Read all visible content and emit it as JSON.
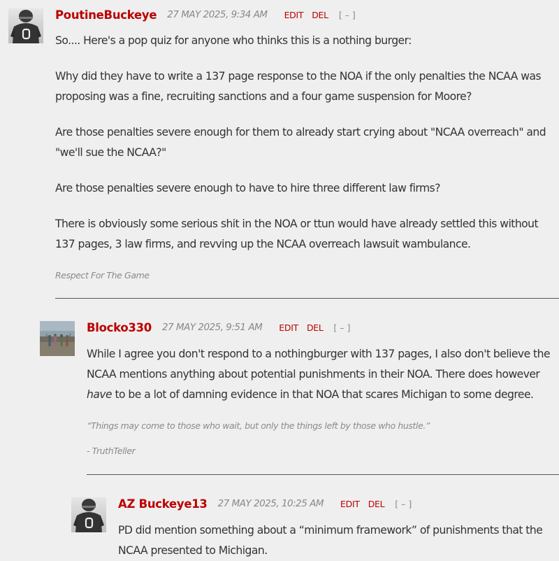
{
  "comments": [
    {
      "author": "PoutineBuckeye",
      "date": "27 MAY 2025, 9:34 AM",
      "edit_label": "EDIT",
      "del_label": "DEL",
      "collapse_label": "[ – ]",
      "avatar_icon": "football-player-avatar-icon",
      "paragraphs": [
        "So.... Here's a pop quiz for anyone who thinks this is a nothing burger:",
        "Why did they have to write a 137 page response to the NOA if the only penalties the NCAA was proposing was a fine, recruiting sanctions and a four game suspension for Moore?",
        "Are those penalties severe enough for them to already start crying about \"NCAA overreach\" and \"we'll sue the NCAA?\"",
        "Are those penalties severe enough to have to hire three different law firms?",
        "There is obviously some serious shit in the NOA or ttun would have already settled this without 137 pages, 3 law firms, and revving up the NCAA overreach lawsuit wambulance."
      ],
      "signature": "Respect For The Game"
    },
    {
      "author": "Blocko330",
      "date": "27 MAY 2025, 9:51 AM",
      "edit_label": "EDIT",
      "del_label": "DEL",
      "collapse_label": "[ – ]",
      "avatar_icon": "beach-photo-avatar-icon",
      "text_before": "While I agree you don't respond to a nothingburger with 137 pages, I also don't believe the NCAA mentions anything about potential punishments in their NOA.  There does however ",
      "text_emphasis": "have",
      "text_after": " to be a lot of damning evidence in that NOA that scares Michigan to some degree.",
      "signature_quote": "“Things may come to those who wait, but only the things left by those who hustle.”",
      "signature_author": "- TruthTeller"
    },
    {
      "author": "AZ Buckeye13",
      "date": "27 MAY 2025, 10:25 AM",
      "edit_label": "EDIT",
      "del_label": "DEL",
      "collapse_label": "[ – ]",
      "avatar_icon": "football-player-avatar-icon",
      "paragraphs": [
        "PD did mention something about a “minimum framework” of punishments that the NCAA presented to Michigan."
      ]
    }
  ],
  "colors": {
    "author": "#bb0000",
    "background": "#efefef",
    "divider": "#555555"
  }
}
